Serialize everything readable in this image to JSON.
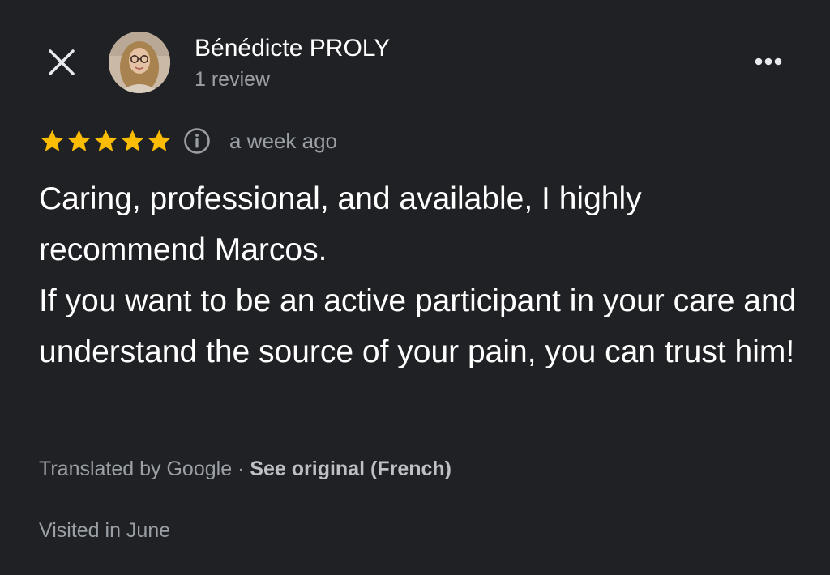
{
  "header": {
    "close_icon": "close-icon",
    "author_name": "Bénédicte PROLY",
    "review_count": "1 review",
    "more_icon": "more-options-icon"
  },
  "rating": {
    "stars": 5,
    "max_stars": 5,
    "star_color": "#fbbc04",
    "info_icon": "info-icon",
    "time_ago": "a week ago"
  },
  "review": {
    "paragraphs": [
      "Caring, professional, and available, I highly recommend Marcos.",
      "If you want to be an active participant in your care and understand the source of your pain, you can trust him!"
    ]
  },
  "translation": {
    "translated_by": "Translated by Google",
    "separator": "·",
    "see_original": "See original (French)"
  },
  "visit": {
    "visited_text": "Visited in June"
  },
  "colors": {
    "background": "#202124",
    "primary_text": "#ffffff",
    "secondary_text": "#9aa0a6"
  }
}
